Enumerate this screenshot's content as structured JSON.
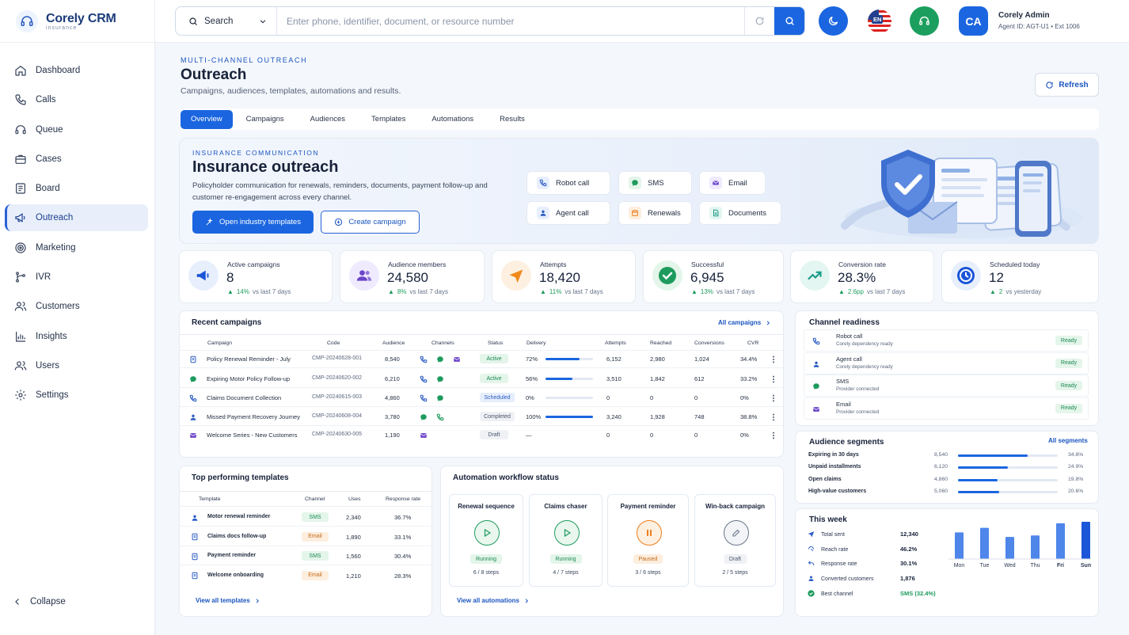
{
  "app": {
    "name": "Corely CRM",
    "sub": "insurance"
  },
  "nav": [
    "Dashboard",
    "Calls",
    "Queue",
    "Cases",
    "Board",
    "Outreach",
    "Marketing",
    "IVR",
    "Customers",
    "Insights",
    "Users",
    "Settings"
  ],
  "collapse": "Collapse",
  "search": {
    "scope": "Search",
    "placeholder": "Enter phone, identifier, document, or resource number"
  },
  "lang": "EN",
  "user": {
    "initials": "CA",
    "name": "Corely Admin",
    "meta": "Agent ID: AGT-U1 • Ext 1006"
  },
  "page": {
    "eyebrow": "MULTI-CHANNEL OUTREACH",
    "title": "Outreach",
    "subtitle": "Campaigns, audiences, templates, automations and results.",
    "refresh": "Refresh"
  },
  "tabs": [
    "Overview",
    "Campaigns",
    "Audiences",
    "Templates",
    "Automations",
    "Results"
  ],
  "hero": {
    "eyebrow": "INSURANCE COMMUNICATION",
    "title": "Insurance outreach",
    "desc": "Policyholder communication for renewals, reminders, documents, payment follow-up and customer re-engagement across every channel.",
    "btn_primary": "Open industry templates",
    "btn_secondary": "Create campaign",
    "chips": [
      "Robot call",
      "SMS",
      "Email",
      "Agent call",
      "Renewals",
      "Documents"
    ]
  },
  "kpis": [
    {
      "label": "Active campaigns",
      "value": "8",
      "delta": "14%",
      "note": "vs last 7 days"
    },
    {
      "label": "Audience members",
      "value": "24,580",
      "delta": "8%",
      "note": "vs last 7 days"
    },
    {
      "label": "Attempts",
      "value": "18,420",
      "delta": "11%",
      "note": "vs last 7 days"
    },
    {
      "label": "Successful",
      "value": "6,945",
      "delta": "13%",
      "note": "vs last 7 days"
    },
    {
      "label": "Conversion rate",
      "value": "28.3%",
      "delta": "2.6pp",
      "note": "vs last 7 days"
    },
    {
      "label": "Scheduled today",
      "value": "12",
      "delta": "2",
      "note": "vs yesterday"
    }
  ],
  "recent": {
    "title": "Recent campaigns",
    "link": "All campaigns",
    "headers": [
      "Campaign",
      "Code",
      "Audience",
      "Channels",
      "Status",
      "Delivery",
      "Attempts",
      "Reached",
      "Conversions",
      "CVR"
    ],
    "rows": [
      {
        "name": "Policy Renewal Reminder - July",
        "code": "CMP-20240628-001",
        "audience": "8,540",
        "status": "Active",
        "delivery": "72%",
        "delivery_frac": 0.72,
        "attempts": "6,152",
        "reached": "2,980",
        "conv": "1,024",
        "cvr": "34.4%"
      },
      {
        "name": "Expiring Motor Policy Follow-up",
        "code": "CMP-20240620-002",
        "audience": "6,210",
        "status": "Active",
        "delivery": "56%",
        "delivery_frac": 0.56,
        "attempts": "3,510",
        "reached": "1,842",
        "conv": "612",
        "cvr": "33.2%"
      },
      {
        "name": "Claims Document Collection",
        "code": "CMP-20240615-003",
        "audience": "4,860",
        "status": "Scheduled",
        "delivery": "0%",
        "delivery_frac": 0,
        "attempts": "0",
        "reached": "0",
        "conv": "0",
        "cvr": "0%"
      },
      {
        "name": "Missed Payment Recovery Journey",
        "code": "CMP-20240608-004",
        "audience": "3,780",
        "status": "Completed",
        "delivery": "100%",
        "delivery_frac": 1,
        "attempts": "3,240",
        "reached": "1,928",
        "conv": "748",
        "cvr": "38.8%"
      },
      {
        "name": "Welcome Series - New Customers",
        "code": "CMP-20240630-005",
        "audience": "1,190",
        "status": "Draft",
        "delivery": "—",
        "delivery_frac": null,
        "attempts": "0",
        "reached": "0",
        "conv": "0",
        "cvr": "0%"
      }
    ]
  },
  "readiness": {
    "title": "Channel readiness",
    "items": [
      {
        "name": "Robot call",
        "sub": "Corely dependency ready",
        "status": "Ready"
      },
      {
        "name": "Agent call",
        "sub": "Corely dependency ready",
        "status": "Ready"
      },
      {
        "name": "SMS",
        "sub": "Provider connected",
        "status": "Ready"
      },
      {
        "name": "Email",
        "sub": "Provider connected",
        "status": "Ready"
      }
    ]
  },
  "segments": {
    "title": "Audience segments",
    "link": "All segments",
    "items": [
      {
        "name": "Expiring in 30 days",
        "count": "8,540",
        "pct": "34.8%",
        "frac": 0.348
      },
      {
        "name": "Unpaid installments",
        "count": "6,120",
        "pct": "24.9%",
        "frac": 0.249
      },
      {
        "name": "Open claims",
        "count": "4,860",
        "pct": "19.8%",
        "frac": 0.198
      },
      {
        "name": "High-value customers",
        "count": "5,060",
        "pct": "20.6%",
        "frac": 0.206
      }
    ]
  },
  "templates": {
    "title": "Top performing templates",
    "headers": [
      "Template",
      "Channel",
      "Uses",
      "Response rate"
    ],
    "rows": [
      {
        "name": "Motor renewal reminder",
        "channel": "SMS",
        "uses": "2,340",
        "rate": "36.7%"
      },
      {
        "name": "Claims docs follow-up",
        "channel": "Email",
        "uses": "1,890",
        "rate": "33.1%"
      },
      {
        "name": "Payment reminder",
        "channel": "SMS",
        "uses": "1,560",
        "rate": "30.4%"
      },
      {
        "name": "Welcome onboarding",
        "channel": "Email",
        "uses": "1,210",
        "rate": "28.3%"
      }
    ],
    "link": "View all templates"
  },
  "automation": {
    "title": "Automation workflow status",
    "link": "View all automations",
    "items": [
      {
        "name": "Renewal sequence",
        "status": "Running",
        "steps": "6 / 8 steps"
      },
      {
        "name": "Claims chaser",
        "status": "Running",
        "steps": "4 / 7 steps"
      },
      {
        "name": "Payment reminder",
        "status": "Paused",
        "steps": "3 / 6 steps"
      },
      {
        "name": "Win-back campaign",
        "status": "Draft",
        "steps": "2 / 5 steps"
      }
    ]
  },
  "week": {
    "title": "This week",
    "rows": [
      {
        "label": "Total sent",
        "value": "12,340"
      },
      {
        "label": "Reach rate",
        "value": "46.2%"
      },
      {
        "label": "Response rate",
        "value": "30.1%"
      },
      {
        "label": "Converted customers",
        "value": "1,876"
      },
      {
        "label": "Best channel",
        "value": "SMS  (32.4%)"
      }
    ]
  },
  "chart_data": {
    "type": "bar",
    "categories": [
      "Mon",
      "Tue",
      "Wed",
      "Thu",
      "Fri",
      "Sun"
    ],
    "values": [
      0.7,
      0.82,
      0.58,
      0.62,
      0.94,
      0.98
    ],
    "ylim": [
      0,
      1
    ],
    "colors": [
      "#4e86ea",
      "#4e86ea",
      "#4e86ea",
      "#4e86ea",
      "#4e86ea",
      "#1b55d8"
    ]
  },
  "colors": {
    "primary": "#1b66e0",
    "success": "#1d9b5d",
    "warn": "#ef7d1a"
  }
}
